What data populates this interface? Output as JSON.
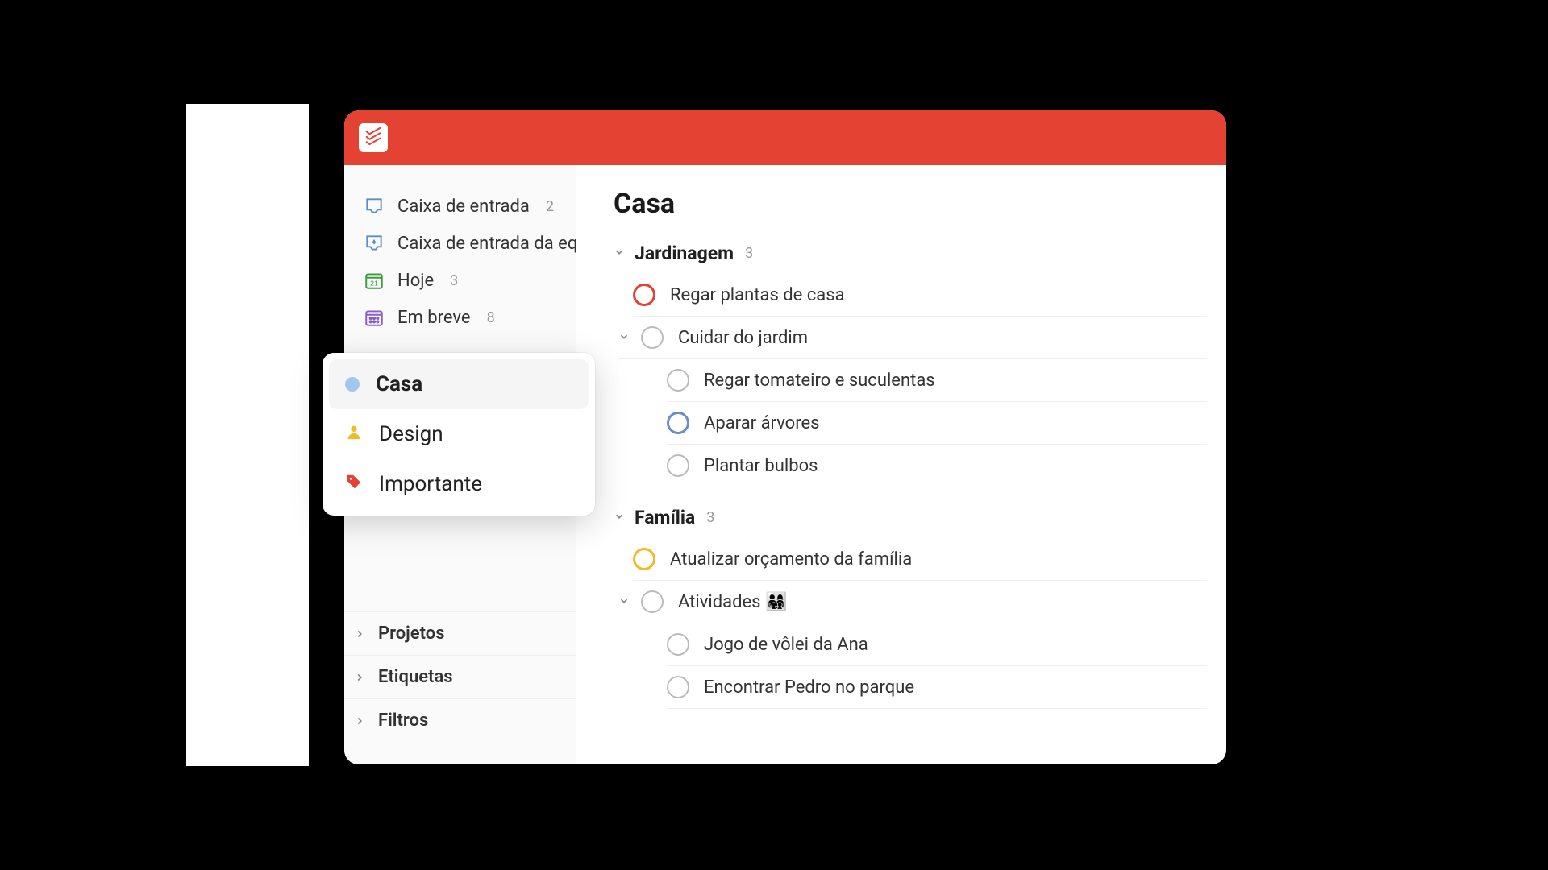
{
  "header": {
    "brand_color": "#e44232"
  },
  "sidebar": {
    "nav": [
      {
        "label": "Caixa de entrada",
        "count": "2",
        "icon": "inbox"
      },
      {
        "label": "Caixa de entrada da equ",
        "count": "",
        "icon": "team-inbox"
      },
      {
        "label": "Hoje",
        "count": "3",
        "icon": "today"
      },
      {
        "label": "Em breve",
        "count": "8",
        "icon": "upcoming"
      }
    ],
    "collapsibles": [
      {
        "label": "Projetos"
      },
      {
        "label": "Etiquetas"
      },
      {
        "label": "Filtros"
      }
    ]
  },
  "popover": {
    "items": [
      {
        "label": "Casa",
        "kind": "dot-blue",
        "selected": true
      },
      {
        "label": "Design",
        "kind": "person"
      },
      {
        "label": "Importante",
        "kind": "tag"
      }
    ]
  },
  "main": {
    "title": "Casa",
    "sections": [
      {
        "title": "Jardinagem",
        "count": "3",
        "tasks": [
          {
            "text": "Regar plantas de casa",
            "priority": "red",
            "has_children": false,
            "children": []
          },
          {
            "text": "Cuidar do jardim",
            "priority": "",
            "has_children": true,
            "children": [
              {
                "text": "Regar tomateiro e suculentas",
                "priority": ""
              },
              {
                "text": "Aparar árvores",
                "priority": "blue"
              },
              {
                "text": "Plantar bulbos",
                "priority": ""
              }
            ]
          }
        ]
      },
      {
        "title": "Família",
        "count": "3",
        "tasks": [
          {
            "text": "Atualizar orçamento da família",
            "priority": "yellow",
            "has_children": false,
            "children": []
          },
          {
            "text": "Atividades 👨‍👩‍👧‍👦",
            "priority": "",
            "has_children": true,
            "children": [
              {
                "text": "Jogo de vôlei da Ana",
                "priority": ""
              },
              {
                "text": "Encontrar Pedro no parque",
                "priority": ""
              }
            ]
          }
        ]
      }
    ]
  }
}
